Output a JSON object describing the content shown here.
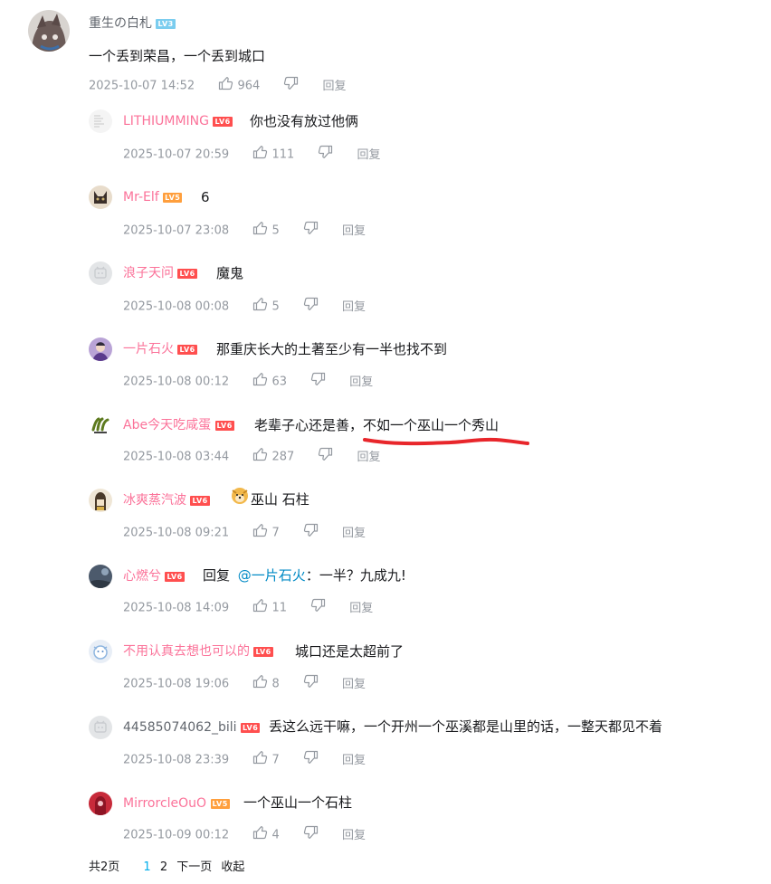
{
  "main_comment": {
    "user": "重生の白札",
    "level": "LV3",
    "text": "一个丢到荣昌，一个丢到城口",
    "time": "2025-10-07 14:52",
    "likes": "964",
    "reply_label": "回复"
  },
  "replies": [
    {
      "user": "LITHIUMMING",
      "level": "LV6",
      "text": "你也没有放过他俩",
      "time": "2025-10-07 20:59",
      "likes": "111",
      "reply_label": "回复"
    },
    {
      "user": "Mr-Elf",
      "level": "LV5",
      "text": "6",
      "time": "2025-10-07 23:08",
      "likes": "5",
      "reply_label": "回复"
    },
    {
      "user": "浪子天问",
      "level": "LV6",
      "text": "魔鬼",
      "time": "2025-10-08 00:08",
      "likes": "5",
      "reply_label": "回复"
    },
    {
      "user": "一片石火",
      "level": "LV6",
      "text": "那重庆长大的土著至少有一半也找不到",
      "time": "2025-10-08 00:12",
      "likes": "63",
      "reply_label": "回复"
    },
    {
      "user": "Abe今天吃咸蛋",
      "level": "LV6",
      "text": "老辈子心还是善，不如一个巫山一个秀山",
      "time": "2025-10-08 03:44",
      "likes": "287",
      "reply_label": "回复"
    },
    {
      "user": "冰爽蒸汽波",
      "level": "LV6",
      "text": "巫山 石柱",
      "time": "2025-10-08 09:21",
      "likes": "7",
      "reply_label": "回复"
    },
    {
      "user": "心燃兮",
      "level": "LV6",
      "reply_prefix": "回复",
      "mention": "@一片石火",
      "text": "：一半？九成九!",
      "time": "2025-10-08 14:09",
      "likes": "11",
      "reply_label": "回复"
    },
    {
      "user": "不用认真去想也可以的",
      "level": "LV6",
      "text": "城口还是太超前了",
      "time": "2025-10-08 19:06",
      "likes": "8",
      "reply_label": "回复"
    },
    {
      "user": "44585074062_bili",
      "level": "LV6",
      "text": "丢这么远干嘛，一个开州一个巫溪都是山里的话，一整天都见不着",
      "time": "2025-10-08 23:39",
      "likes": "7",
      "reply_label": "回复"
    },
    {
      "user": "MirrorcleOuO",
      "level": "LV5",
      "text": "一个巫山一个石柱",
      "time": "2025-10-09 00:12",
      "likes": "4",
      "reply_label": "回复"
    }
  ],
  "pagination": {
    "total": "共2页",
    "page1": "1",
    "page2": "2",
    "next": "下一页",
    "collapse": "收起"
  },
  "colors": {
    "username_pink": "#fb7299",
    "meta_gray": "#9499a0",
    "mention_blue": "#008ac5",
    "underline_red": "#e8262b"
  }
}
